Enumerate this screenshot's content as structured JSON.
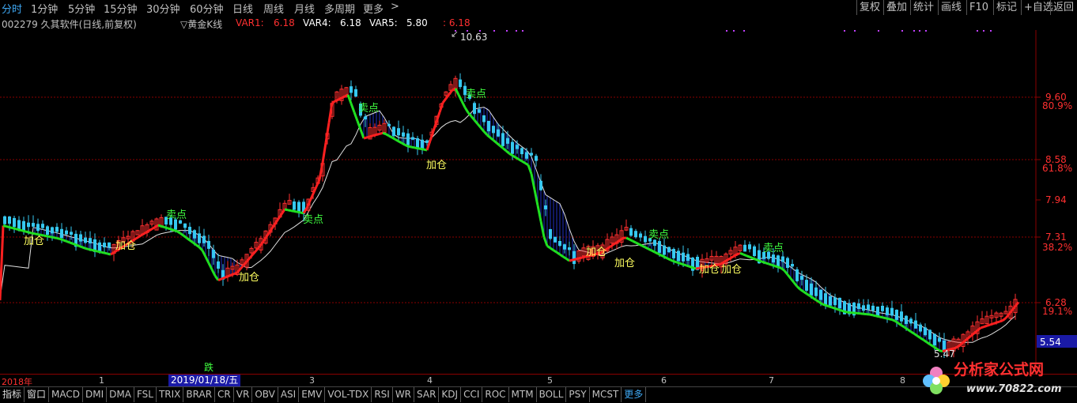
{
  "periods": [
    "分时",
    "1分钟",
    "5分钟",
    "15分钟",
    "30分钟",
    "60分钟",
    "日线",
    "周线",
    "月线",
    "多周期",
    "更多",
    ">"
  ],
  "tools": [
    "复权",
    "叠加",
    "统计",
    "画线",
    "F10",
    "标记",
    "+自选",
    "返回"
  ],
  "info": {
    "stock": "002279 久其软件(日线,前复权)",
    "indicator": "▽黄金K线",
    "var1_label": "VAR1:",
    "var1_value": "6.18",
    "var4_label": "VAR4:",
    "var4_value": "6.18",
    "var5_label": "VAR5:",
    "var5_value": "5.80",
    "var_extra": ": 6.18"
  },
  "price_axis": {
    "prices": [
      "9.60",
      "8.58",
      "7.94",
      "7.31",
      "6.28"
    ],
    "percents": [
      "80.9%",
      "61.8%",
      "38.2%",
      "19.1%"
    ],
    "current": "5.54"
  },
  "annotations": {
    "high": "10.63",
    "low": "5.47",
    "buy": "加仓",
    "sell": "卖点",
    "fall": "跌"
  },
  "x_axis": {
    "year": "2018年",
    "months": [
      "1",
      "2",
      "3",
      "4",
      "5",
      "6",
      "7",
      "8"
    ],
    "cursor_date": "2019/01/18/五"
  },
  "indicator_tabs": [
    "指标",
    "窗口",
    "MACD",
    "DMI",
    "DMA",
    "FSL",
    "TRIX",
    "BRAR",
    "CR",
    "VR",
    "OBV",
    "ASI",
    "EMV",
    "VOL-TDX",
    "RSI",
    "WR",
    "SAR",
    "KDJ",
    "CCI",
    "ROC",
    "MTM",
    "BOLL",
    "PSY",
    "MCST",
    "更多"
  ],
  "watermark": {
    "name": "分析家公式网",
    "url": "www.70822.com"
  },
  "chart_data": {
    "type": "candlestick",
    "title": "002279 久其软件(日线,前复权)",
    "ylim": [
      5.3,
      10.9
    ],
    "price_levels": [
      9.6,
      8.58,
      7.94,
      7.31,
      6.28
    ],
    "fib_levels": {
      "80.9%": 9.6,
      "61.8%": 8.58,
      "38.2%": 7.31,
      "19.1%": 6.28
    },
    "high": 10.63,
    "low": 5.47,
    "last": 5.54,
    "colors": {
      "up": "#ff3030",
      "down": "#36c8f0",
      "trend_up": "#ff2020",
      "trend_down": "#20e020",
      "fill": "#2030c0",
      "slow": "#e0e0e0"
    }
  }
}
